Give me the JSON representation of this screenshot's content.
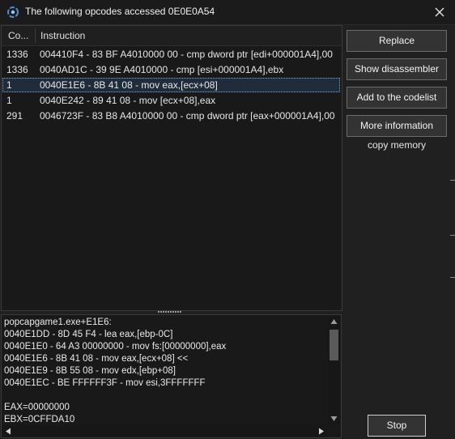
{
  "window": {
    "title": "The following opcodes accessed 0E0E0A54",
    "close_glyph": "✕"
  },
  "list": {
    "columns": {
      "count": "Co...",
      "instruction": "Instruction"
    },
    "rows": [
      {
        "count": "1336",
        "instruction": "004410F4 - 83 BF A4010000 00 - cmp dword ptr [edi+000001A4],00",
        "selected": false
      },
      {
        "count": "1336",
        "instruction": "0040AD1C - 39 9E A4010000  - cmp [esi+000001A4],ebx",
        "selected": false
      },
      {
        "count": "1",
        "instruction": "0040E1E6 - 8B 41 08  - mov eax,[ecx+08]",
        "selected": true
      },
      {
        "count": "1",
        "instruction": "0040E242 - 89 41 08  - mov [ecx+08],eax",
        "selected": false
      },
      {
        "count": "291",
        "instruction": "0046723F - 83 B8 A4010000 00 - cmp dword ptr [eax+000001A4],00",
        "selected": false
      }
    ]
  },
  "details": {
    "lines": [
      "popcapgame1.exe+E1E6:",
      "0040E1DD - 8D 45 F4  - lea eax,[ebp-0C]",
      "0040E1E0 - 64 A3 00000000 - mov fs:[00000000],eax",
      "0040E1E6 - 8B 41 08  - mov eax,[ecx+08] <<",
      "0040E1E9 - 8B 55 08  - mov edx,[ebp+08]",
      "0040E1EC - BE FFFFFF3F - mov esi,3FFFFFFF",
      "",
      "EAX=00000000",
      "EBX=0CFFDA10"
    ]
  },
  "buttons": {
    "replace": "Replace",
    "show_disassembler": "Show disassembler",
    "add_to_codelist": "Add to the codelist",
    "more_information": "More information",
    "copy_memory": "copy memory",
    "stop": "Stop"
  },
  "colors": {
    "background": "#202020",
    "panel": "#191919",
    "selection": "#1f2d3b",
    "text": "#e6e6e6"
  },
  "icons": {
    "app": "cheat-engine-icon",
    "close": "close-icon"
  }
}
